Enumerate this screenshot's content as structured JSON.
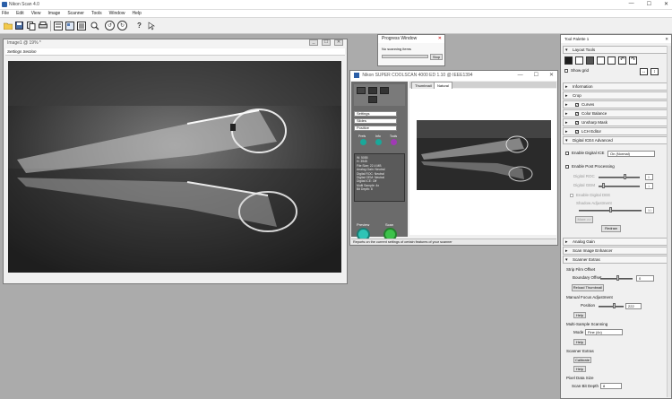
{
  "app": {
    "title": "Nikon Scan 4.0",
    "min": "—",
    "max": "☐",
    "close": "✕"
  },
  "menu": [
    "File",
    "Edit",
    "View",
    "Image",
    "Scanner",
    "Tools",
    "Window",
    "Help"
  ],
  "toolbar": {
    "icons": [
      "open-icon",
      "save-icon",
      "copy-icon",
      "print-icon",
      "prefs-icon",
      "browser-icon",
      "zoom-icon",
      "rotate-left-icon",
      "rotate-right-icon",
      "help-icon",
      "context-help-icon"
    ],
    "help_glyph": "?"
  },
  "image_window": {
    "title": "Image1 @ 19% *",
    "settings_label": "Settings Section",
    "ctrls": [
      "_",
      "☐",
      "✕"
    ]
  },
  "progress_window": {
    "title": "Progress Window",
    "status": "No scanning items",
    "stop": "Stop",
    "close": "✕"
  },
  "scanner_window": {
    "title": "Nikon SUPER COOLSCAN 4000 ED 1.10 @ IEEE1394",
    "tabs": [
      "Thumbnail",
      "Natural"
    ],
    "dropdowns": [
      "Settings",
      "Slides",
      "Positive"
    ],
    "icons_labels": [
      "Prefs",
      "Info",
      "Tools"
    ],
    "info_lines": [
      "W: 5055",
      "H: 3945",
      "File Size: 22.4 MB",
      "Analog Gain: Neutral",
      "Digital ROC: Neutral",
      "Digital GEM: Neutral",
      "Digital ICE: Off",
      "Multi Sample: 4x",
      "Bit Depth: 8"
    ],
    "preview": "Preview",
    "scan": "Scan",
    "status": "Reports on the current settings of certain features of your scanner",
    "ctrls": [
      "—",
      "☐",
      "✕"
    ]
  },
  "tool_palette": {
    "title": "Tool Palette 1",
    "close": "✕",
    "layout_tools": "Layout Tools",
    "show_grid": "Show grid",
    "sections": [
      "Information",
      "Crop",
      "Curves",
      "Color Balance",
      "Unsharp Mask",
      "LCH Editor",
      "Digital ICE4 Advanced"
    ],
    "checked_sections": [
      "Curves",
      "Color Balance",
      "Unsharp Mask",
      "LCH Editor"
    ],
    "ice": {
      "enable_ice": "Enable Digital ICE",
      "ice_mode": "On (Normal)",
      "enable_post": "Enable Post Processing",
      "roc": "Digital ROC",
      "gem": "Digital GEM",
      "roc_val": "5",
      "gem_val": "1",
      "enable_dee": "Enable Digital DEE",
      "shadow": "Shadow Adjustment",
      "dee_val": "50",
      "more": "More >>",
      "redraw": "Redraw"
    },
    "sections2": [
      "Analog Gain",
      "Scan Image Enhancer",
      "Scanner Extras"
    ],
    "extras": {
      "strip_offset": "Strip Film Offset",
      "boundary_offset": "Boundary Offset",
      "boundary_val": "0",
      "reload": "Reload Thumbnail",
      "manual_focus": "Manual Focus Adjustment",
      "position": "Position",
      "position_val": "222",
      "help1": "Help",
      "multi_sample": "Multi-Sample Scanning",
      "mode": "Mode",
      "mode_val": "Fine (4x)",
      "help2": "Help",
      "scanner_extras": "Scanner Extras",
      "calibrate": "Calibrate",
      "help3": "Help",
      "pixel_size": "Pixel Data Size",
      "bit_depth": "Scan Bit Depth",
      "bit_val": "8"
    }
  }
}
